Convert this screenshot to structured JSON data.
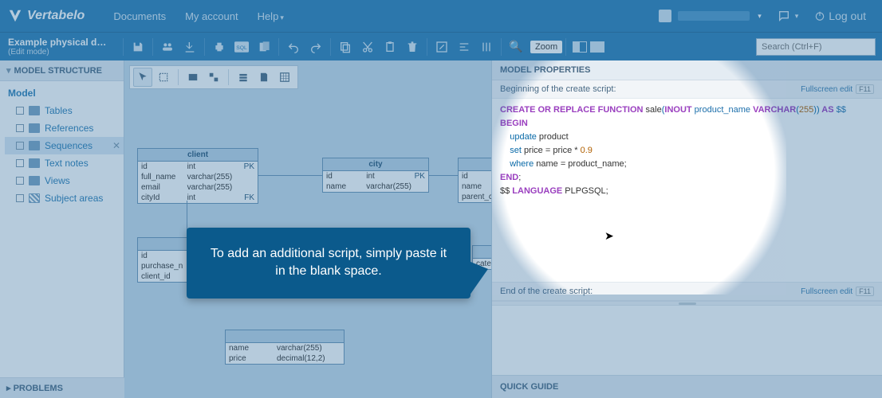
{
  "app": {
    "name": "Vertabelo"
  },
  "topnav": {
    "documents": "Documents",
    "my_account": "My account",
    "help": "Help",
    "logout": "Log out"
  },
  "second_bar": {
    "model_title": "Example physical da…",
    "mode": "(Edit mode)",
    "zoom_label": "Zoom",
    "search_placeholder": "Search (Ctrl+F)"
  },
  "left_panel": {
    "header": "MODEL STRUCTURE",
    "root": "Model",
    "items": [
      "Tables",
      "References",
      "Sequences",
      "Text notes",
      "Views",
      "Subject areas"
    ],
    "problems": "PROBLEMS"
  },
  "er": {
    "client": {
      "name": "client",
      "rows": [
        {
          "col": "id",
          "type": "int",
          "key": "PK"
        },
        {
          "col": "full_name",
          "type": "varchar(255)",
          "key": ""
        },
        {
          "col": "email",
          "type": "varchar(255)",
          "key": ""
        },
        {
          "col": "cityId",
          "type": "int",
          "key": "FK"
        }
      ]
    },
    "city": {
      "name": "city",
      "rows": [
        {
          "col": "id",
          "type": "int",
          "key": "PK"
        },
        {
          "col": "name",
          "type": "varchar(255)",
          "key": ""
        }
      ]
    },
    "frag1": {
      "rows": [
        {
          "col": "id",
          "type": "",
          "key": ""
        },
        {
          "col": "name",
          "type": "",
          "key": ""
        },
        {
          "col": "parent_c",
          "type": "",
          "key": ""
        }
      ]
    },
    "purchase": {
      "rows": [
        {
          "col": "id",
          "type": "",
          "key": ""
        },
        {
          "col": "purchase_n",
          "type": "",
          "key": ""
        },
        {
          "col": "client_id",
          "type": "",
          "key": ""
        }
      ]
    },
    "product": {
      "rows": [
        {
          "col": "name",
          "type": "varchar(255)",
          "key": ""
        },
        {
          "col": "price",
          "type": "decimal(12,2)",
          "key": ""
        }
      ]
    },
    "cate": {
      "rows": [
        {
          "col": "cate",
          "type": "",
          "key": ""
        }
      ]
    }
  },
  "right_panel": {
    "header": "MODEL PROPERTIES",
    "begin_label": "Beginning of the create script:",
    "end_label": "End of the create script:",
    "fullscreen": "Fullscreen edit",
    "fkey": "F11",
    "quick_guide": "QUICK GUIDE",
    "script": {
      "l1a": "CREATE OR REPLACE FUNCTION",
      "l1b": " sale",
      "l1c": "(",
      "l1d": "INOUT",
      "l1e": " product_name ",
      "l1f": "VARCHAR",
      "l1g": "(",
      "l1h": "255",
      "l1i": "))",
      "l1j": " AS ",
      "l1k": "$$",
      "l2": "BEGIN",
      "l3a": "    update",
      "l3b": " product",
      "l4a": "    set",
      "l4b": " price = price * ",
      "l4c": "0.9",
      "l5a": "    where",
      "l5b": " name = product_name;",
      "l6": "END",
      "l6b": ";",
      "l7a": "$$ ",
      "l7b": "LANGUAGE",
      "l7c": " PLPGSQL;"
    }
  },
  "callout": {
    "text": "To add an additional script, simply paste it in the blank space."
  }
}
